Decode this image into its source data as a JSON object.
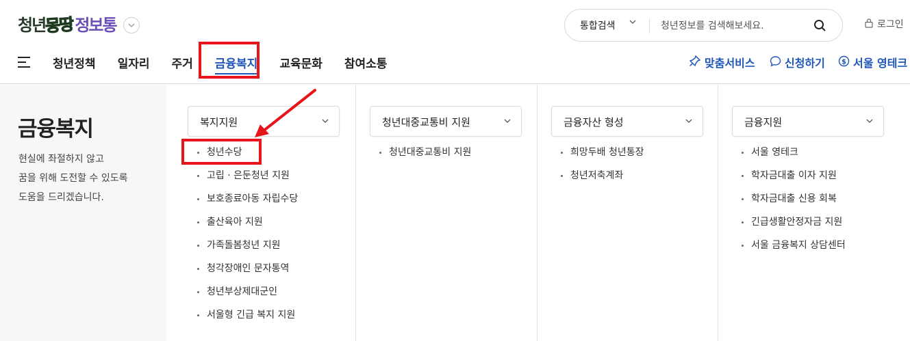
{
  "header": {
    "logo": [
      "청년",
      "몽땅",
      "정보통"
    ],
    "search_type": "통합검색",
    "search_placeholder": "청년정보를 검색해보세요.",
    "login": "로그인"
  },
  "nav": [
    "청년정책",
    "일자리",
    "주거",
    "금융복지",
    "교육문화",
    "참여소통"
  ],
  "nav_active": "금융복지",
  "quick_links": [
    "맞춤서비스",
    "신청하기",
    "서울 영테크"
  ],
  "intro": {
    "title": "금융복지",
    "desc": [
      "현실에 좌절하지 않고",
      "꿈을 위해 도전할 수 있도록",
      "도움을 드리겠습니다."
    ]
  },
  "columns": [
    {
      "category": "복지지원",
      "items": [
        "청년수당",
        "고립 · 은둔청년 지원",
        "보호종료아동 자립수당",
        "출산육아 지원",
        "가족돌봄청년 지원",
        "청각장애인 문자통역",
        "청년부상제대군인",
        "서울형 긴급 복지 지원"
      ]
    },
    {
      "category": "청년대중교통비 지원",
      "items": [
        "청년대중교통비 지원"
      ]
    },
    {
      "category": "금융자산 형성",
      "items": [
        "희망두배 청년통장",
        "청년저축계좌"
      ]
    },
    {
      "category": "금융지원",
      "items": [
        "서울 영테크",
        "학자금대출 이자 지원",
        "학자금대출 신용 회복",
        "긴급생활안정자금 지원",
        "서울 금융복지 상담센터"
      ]
    }
  ],
  "colors": {
    "accent": "#1f56b8",
    "highlight": "#e8141c"
  },
  "icons": [
    "chevron-down-icon",
    "search-icon",
    "lock-icon",
    "hamburger-icon",
    "pin-icon",
    "chat-icon",
    "coin-icon",
    "arrow-icon"
  ]
}
